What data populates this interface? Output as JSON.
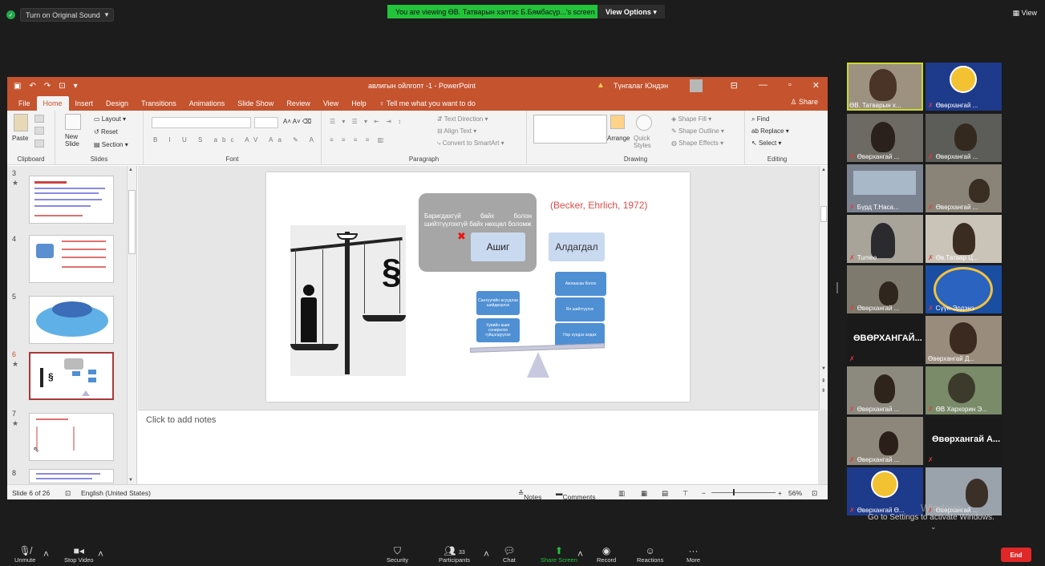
{
  "zoom": {
    "original_sound_label": "Turn on Original Sound",
    "viewing_banner": "You are viewing ӨВ. Татварын хэлтэс Б.Бямбасүр...'s screen",
    "view_options_label": "View Options",
    "view_label": "View",
    "toolbar": {
      "unmute": "Unmute",
      "stop_video": "Stop Video",
      "security": "Security",
      "participants": "Participants",
      "participants_count": "33",
      "chat": "Chat",
      "share_screen": "Share Screen",
      "record": "Record",
      "reactions": "Reactions",
      "more": "More",
      "end": "End"
    },
    "windows_watermark": "Go to Settings to activate Windows.",
    "windows_watermark_title": "Windows",
    "participants": [
      {
        "name": "ӨВ. Татварын х...",
        "active": true
      },
      {
        "name": "Өвөрхангай ..."
      },
      {
        "name": "Өвөрхангай ..."
      },
      {
        "name": "Өвөрхангай ..."
      },
      {
        "name": "Бүрд Т.Наса..."
      },
      {
        "name": "Өвөрхангай ..."
      },
      {
        "name": "Tumee"
      },
      {
        "name": "Өв.Татвар Ц..."
      },
      {
        "name": "Өвөрхангай ..."
      },
      {
        "name": "Сүүн-Эрдэнэ"
      },
      {
        "name": "ӨВӨРХАНГАЙ...",
        "big": true
      },
      {
        "name": "Өвөрхангай Д..."
      },
      {
        "name": "Өвөрхангай ..."
      },
      {
        "name": "ӨВ Хархорин Э..."
      },
      {
        "name": "Өвөрхангай ..."
      },
      {
        "name": "Өвөрхангай А...",
        "big": true
      },
      {
        "name": "Өвөрхангай Ө..."
      },
      {
        "name": "Өвөрхангай ..."
      }
    ]
  },
  "ppt": {
    "doc_title": "авлигын ойлгопт -1  -  PowerPoint",
    "user": "Түнгалаг Юндэн",
    "tabs": [
      "File",
      "Home",
      "Insert",
      "Design",
      "Transitions",
      "Animations",
      "Slide Show",
      "Review",
      "View",
      "Help"
    ],
    "tell_me": "Tell me what you want to do",
    "share": "Share",
    "ribbon": {
      "paste": "Paste",
      "clipboard": "Clipboard",
      "new_slide": "New Slide",
      "layout": "Layout",
      "reset": "Reset",
      "section": "Section",
      "slides": "Slides",
      "font": "Font",
      "paragraph": "Paragraph",
      "text_direction": "Text Direction",
      "align_text": "Align Text",
      "convert_smartart": "Convert to SmartArt",
      "arrange": "Arrange",
      "quick_styles": "Quick Styles",
      "shape_fill": "Shape Fill",
      "shape_outline": "Shape Outline",
      "shape_effects": "Shape Effects",
      "drawing": "Drawing",
      "find": "Find",
      "replace": "Replace",
      "select": "Select",
      "editing": "Editing"
    },
    "thumbs": [
      {
        "num": "3",
        "star": true
      },
      {
        "num": "4",
        "star": false
      },
      {
        "num": "5",
        "star": false
      },
      {
        "num": "6",
        "star": true,
        "selected": true
      },
      {
        "num": "7",
        "star": true
      },
      {
        "num": "8",
        "star": false
      }
    ],
    "notes_placeholder": "Click to add notes",
    "status": {
      "slide_of": "Slide 6 of 26",
      "language": "English (United States)",
      "notes": "Notes",
      "comments": "Comments",
      "zoom": "56%"
    },
    "slide": {
      "gray_text": "Баригдахгүй байх болон шийтгүүлэхгүй байх нөхцөл боломж",
      "citation": "(Becker, Ehrlich, 1972)",
      "ashig": "Ашиг",
      "aldagdal": "Алдагдал",
      "left_boxes": [
        "Санхүүгийн асуудлаа шийдвэрлэх",
        "Хувийн ашиг сонирхлоо гүйцэлдүүлэх"
      ],
      "right_boxes": [
        "Ажлаасаа болох",
        "Ял шийтгүүлэх",
        "Нэр хүндээ алдах"
      ]
    }
  }
}
